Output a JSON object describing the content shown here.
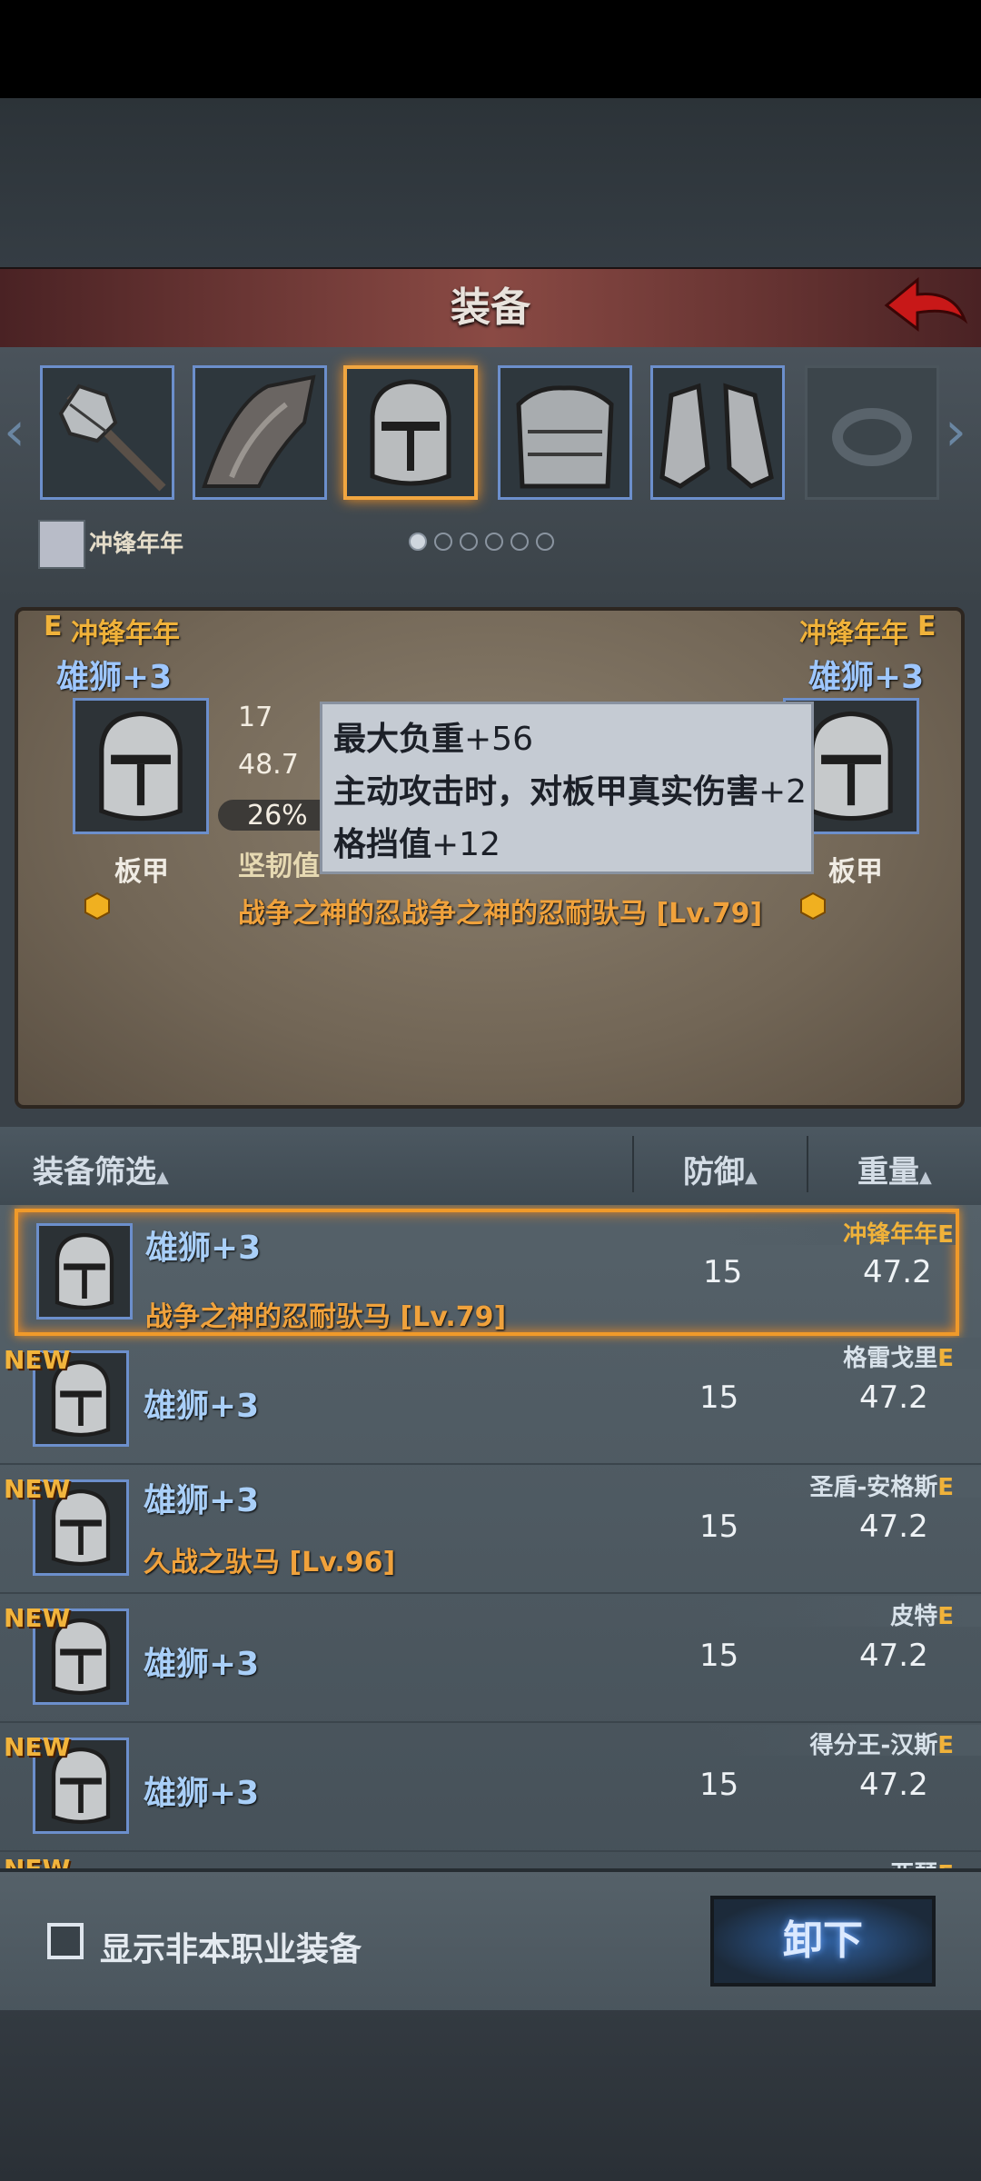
{
  "header": {
    "title": "装备"
  },
  "character": {
    "name": "冲锋年年"
  },
  "slots": [
    {
      "name": "mace-slot"
    },
    {
      "name": "cloak-slot"
    },
    {
      "name": "helmet-slot",
      "selected": true
    },
    {
      "name": "chest-armor-slot"
    },
    {
      "name": "boots-slot"
    },
    {
      "name": "ring-slot",
      "empty": true
    }
  ],
  "compare": {
    "left": {
      "owner": "冲锋年年",
      "grade": "E",
      "item": "雄狮+3",
      "type": "板甲"
    },
    "right": {
      "owner": "冲锋年年",
      "grade": "E",
      "item": "雄狮+3",
      "type": "板甲"
    },
    "stats": {
      "v1": "17",
      "v2": "48.7",
      "pct": "26%",
      "label": "坚韧值"
    },
    "enchant": "战争之神的忍战争之神的忍耐驮马",
    "enchant_lv": "[Lv.79]"
  },
  "tooltip": {
    "line1_a": "最大负重",
    "line1_b": "+56",
    "line2_a": "主动攻击时，对板甲真实伤害",
    "line2_b": "+2",
    "line3_a": "格挡值",
    "line3_b": "+12"
  },
  "filter": {
    "label": "装备筛选",
    "defense": "防御",
    "weight": "重量"
  },
  "items": [
    {
      "new": "",
      "name": "雄狮+3",
      "sub": "战争之神的忍耐驮马",
      "lv": "[Lv.79]",
      "defense": "15",
      "weight": "47.2",
      "owner": "冲锋年年",
      "grade": "E"
    },
    {
      "new": "NEW",
      "name": "雄狮+3",
      "sub": "",
      "lv": "",
      "defense": "15",
      "weight": "47.2",
      "owner": "格雷戈里",
      "grade": "E"
    },
    {
      "new": "NEW",
      "name": "雄狮+3",
      "sub": "久战之驮马",
      "lv": "[Lv.96]",
      "defense": "15",
      "weight": "47.2",
      "owner": "圣盾-安格斯",
      "grade": "E"
    },
    {
      "new": "NEW",
      "name": "雄狮+3",
      "sub": "",
      "lv": "",
      "defense": "15",
      "weight": "47.2",
      "owner": "皮特",
      "grade": "E"
    },
    {
      "new": "NEW",
      "name": "雄狮+3",
      "sub": "",
      "lv": "",
      "defense": "15",
      "weight": "47.2",
      "owner": "得分王-汉斯",
      "grade": "E"
    },
    {
      "new": "NEW",
      "name": "",
      "sub": "",
      "lv": "",
      "defense": "",
      "weight": "",
      "owner": "亚瑟",
      "grade": "E"
    }
  ],
  "footer": {
    "checkbox_label": "显示非本职业装备",
    "unequip": "卸下"
  },
  "colors": {
    "accent": "#f0a23c",
    "blue_text": "#a9cff8",
    "selected_border": "#f09a2a"
  }
}
